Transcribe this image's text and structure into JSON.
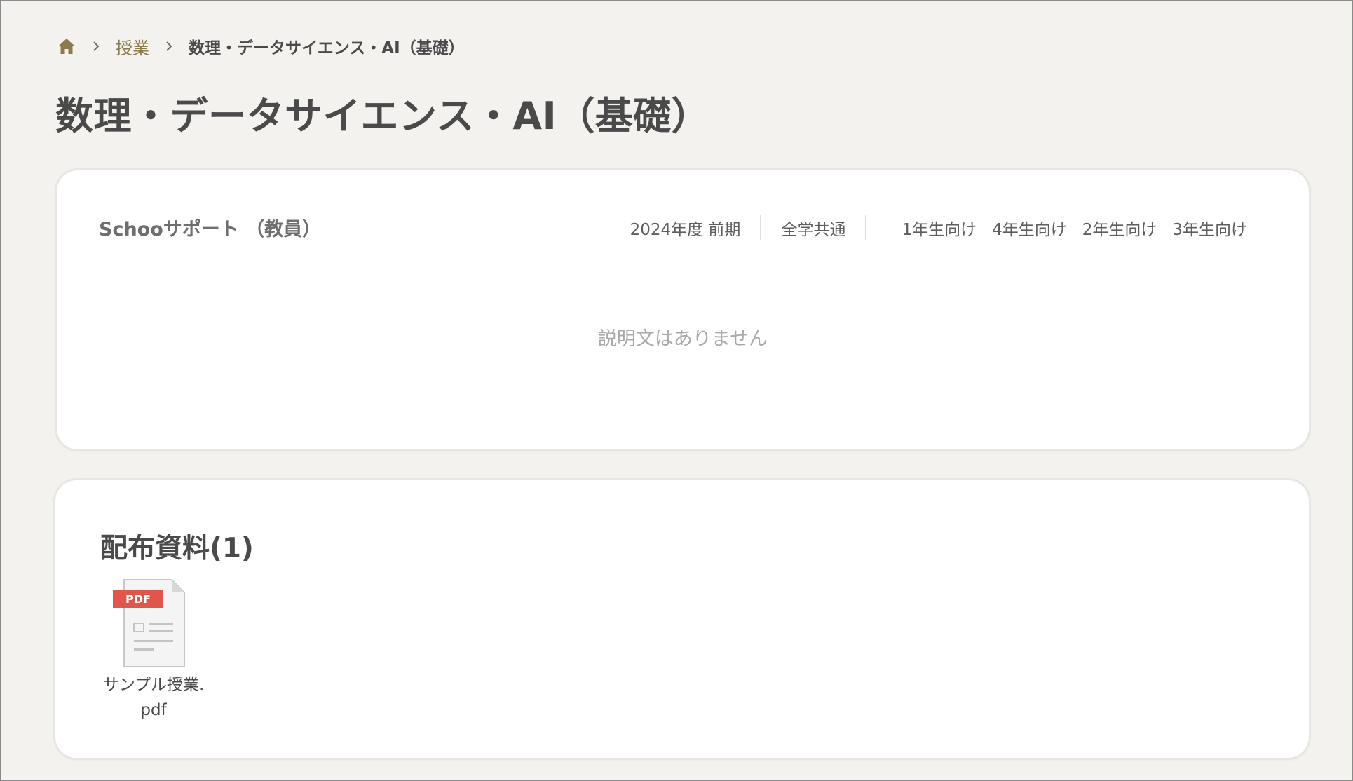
{
  "breadcrumb": {
    "home_icon": "home-icon",
    "separator_icon": "chevron-right-icon",
    "items": [
      {
        "label": "授業"
      },
      {
        "label": "数理・データサイエンス・AI（基礎）"
      }
    ]
  },
  "page": {
    "title": "数理・データサイエンス・AI（基礎）"
  },
  "course": {
    "teacher": "Schooサポート （教員）",
    "term": "2024年度 前期",
    "department": "全学共通",
    "targets": [
      "1年生向け",
      "4年生向け",
      "2年生向け",
      "3年生向け"
    ],
    "description_empty": "説明文はありません"
  },
  "materials": {
    "title": "配布資料(1)",
    "files": [
      {
        "name_line1": "サンプル授業.",
        "name_line2": "pdf",
        "type_badge": "PDF",
        "icon": "pdf-file-icon"
      }
    ]
  },
  "colors": {
    "background": "#f3f2ef",
    "card": "#ffffff",
    "link": "#8c7a4f",
    "pdf_badge": "#e0564a",
    "muted_text": "#a9a9a9"
  }
}
